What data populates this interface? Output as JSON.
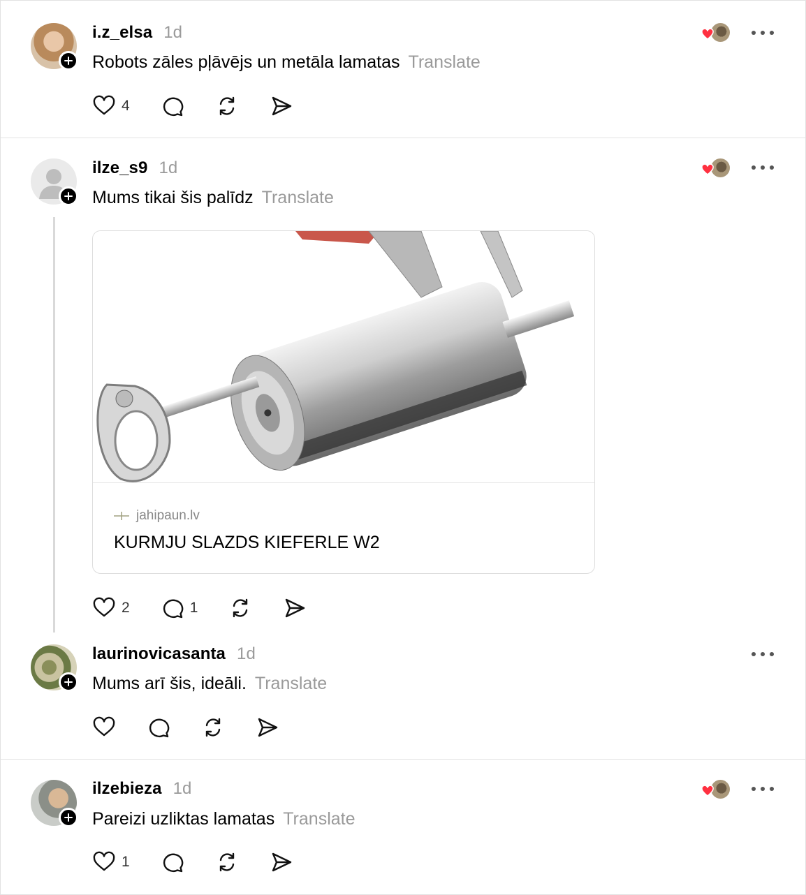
{
  "posts": [
    {
      "username": "i.z_elsa",
      "time": "1d",
      "text": "Robots zāles pļāvējs un metāla lamatas",
      "translate": "Translate",
      "likes": "4",
      "replies": "",
      "liked_by_author": true
    },
    {
      "username": "ilze_s9",
      "time": "1d",
      "text": "Mums tikai šis palīdz",
      "translate": "Translate",
      "likes": "2",
      "replies": "1",
      "liked_by_author": true,
      "link_card": {
        "domain": "jahipaun.lv",
        "title": "KURMJU SLAZDS KIEFERLE W2"
      }
    },
    {
      "username": "laurinovicasanta",
      "time": "1d",
      "text": "Mums arī šis, ideāli.",
      "translate": "Translate",
      "likes": "",
      "replies": "",
      "liked_by_author": false
    },
    {
      "username": "ilzebieza",
      "time": "1d",
      "text": "Pareizi uzliktas lamatas",
      "translate": "Translate",
      "likes": "1",
      "replies": "",
      "liked_by_author": true
    }
  ],
  "colors": {
    "heart_red": "#ff3040",
    "muted_text": "#9a9a9a",
    "divider": "#e2e2e2"
  },
  "icons": [
    "plus-icon",
    "heart-icon",
    "comment-icon",
    "repost-icon",
    "share-icon",
    "more-icon"
  ]
}
